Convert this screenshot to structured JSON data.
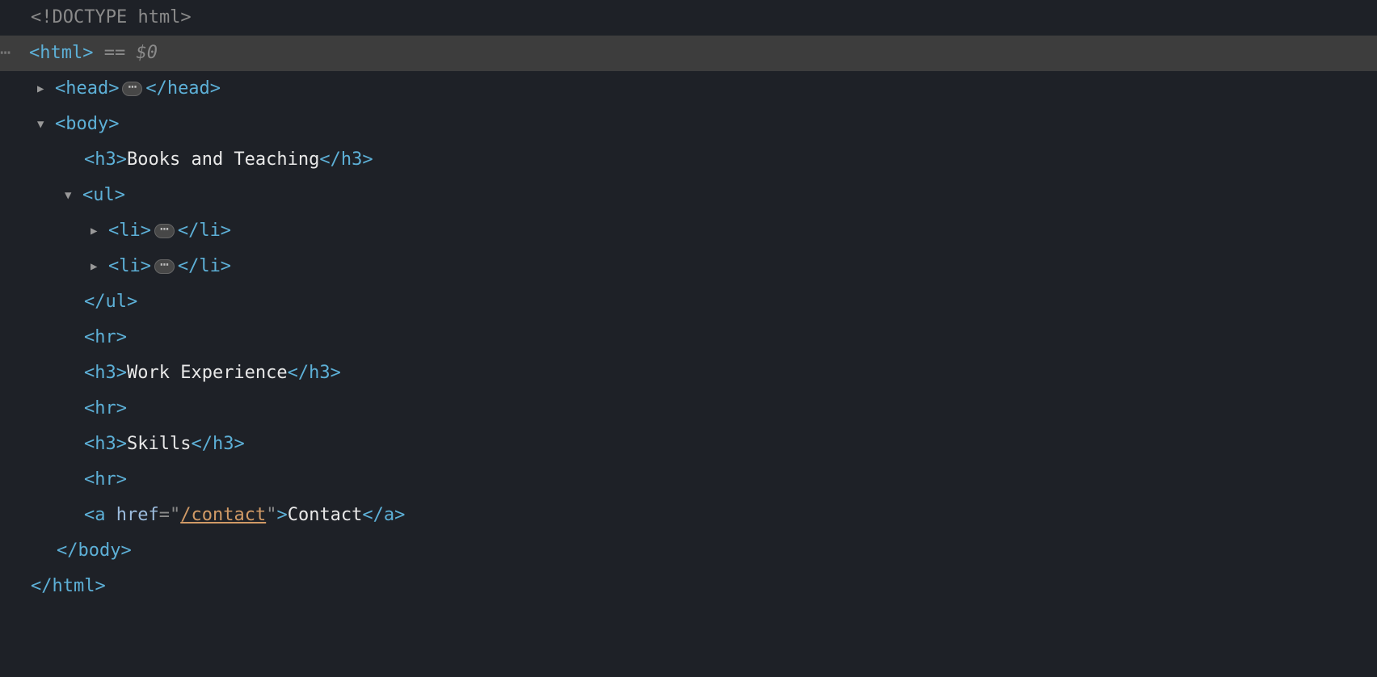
{
  "lines": {
    "doctype": "<!DOCTYPE html>",
    "html_open": "<html>",
    "selected_suffix_eq": " == ",
    "selected_suffix_var": "$0",
    "head_open": "<head>",
    "head_close": "</head>",
    "body_open": "<body>",
    "h3_open": "<h3>",
    "h3_close": "</h3>",
    "h3_text_1": "Books and Teaching",
    "ul_open": "<ul>",
    "ul_close": "</ul>",
    "li_open": "<li>",
    "li_close": "</li>",
    "hr": "<hr>",
    "h3_text_2": "Work Experience",
    "h3_text_3": "Skills",
    "a_open1": "<a ",
    "a_attr_name": "href",
    "a_attr_eq": "=",
    "a_attr_q": "\"",
    "a_attr_val": "/contact",
    "a_open2": ">",
    "a_text": "Contact",
    "a_close": "</a>",
    "body_close": "</body>",
    "html_close": "</html>",
    "gutter_dots": "⋯"
  }
}
